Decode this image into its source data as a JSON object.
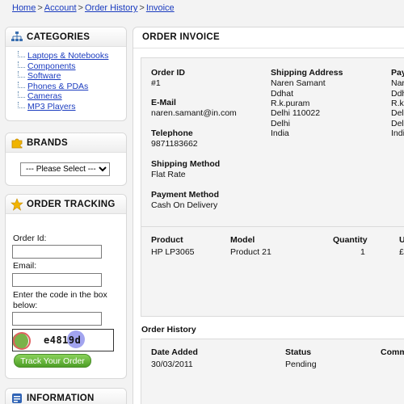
{
  "breadcrumb": {
    "items": [
      "Home",
      "Account",
      "Order History",
      "Invoice"
    ],
    "separator": ">"
  },
  "categories": {
    "title": "CATEGORIES",
    "items": [
      "Laptops & Notebooks",
      "Components",
      "Software",
      "Phones & PDAs",
      "Cameras",
      "MP3 Players"
    ]
  },
  "brands": {
    "title": "BRANDS",
    "select_value": "--- Please Select ---"
  },
  "order_tracking": {
    "title": "ORDER TRACKING",
    "order_id_label": "Order Id:",
    "email_label": "Email:",
    "code_label_1": "Enter the code in the box",
    "code_label_2": "below:",
    "captcha_text": "e4819d",
    "button_label": "Track Your Order"
  },
  "information": {
    "title": "INFORMATION"
  },
  "invoice": {
    "title": "ORDER INVOICE",
    "order_id_label": "Order ID",
    "order_id_value": "#1",
    "email_label": "E-Mail",
    "email_value": "naren.samant@in.com",
    "telephone_label": "Telephone",
    "telephone_value": "9871183662",
    "shipping_method_label": "Shipping Method",
    "shipping_method_value": "Flat Rate",
    "payment_method_label": "Payment Method",
    "payment_method_value": "Cash On Delivery",
    "shipping_address_label": "Shipping Address",
    "shipping_address_lines": [
      "Naren Samant",
      "Ddhat",
      "R.k.puram",
      "Delhi 110022",
      "Delhi",
      "India"
    ],
    "payment_address_label": "Pay",
    "payment_address_lines": [
      "Nar",
      "Ddh",
      "R.k.",
      "Dell",
      "Dell",
      "Indi"
    ]
  },
  "products": {
    "headers": [
      "Product",
      "Model",
      "Quantity",
      "U"
    ],
    "rows": [
      {
        "product": "HP LP3065",
        "model": "Product 21",
        "quantity": "1",
        "unit": "£"
      }
    ]
  },
  "history": {
    "title": "Order History",
    "headers": [
      "Date Added",
      "Status",
      "Comm"
    ],
    "rows": [
      {
        "date": "30/03/2011",
        "status": "Pending",
        "comment": ""
      }
    ]
  },
  "colors": {
    "link": "#1a3bbf",
    "button_green": "#4d9e26",
    "panel_bg": "#f4f4f4"
  }
}
